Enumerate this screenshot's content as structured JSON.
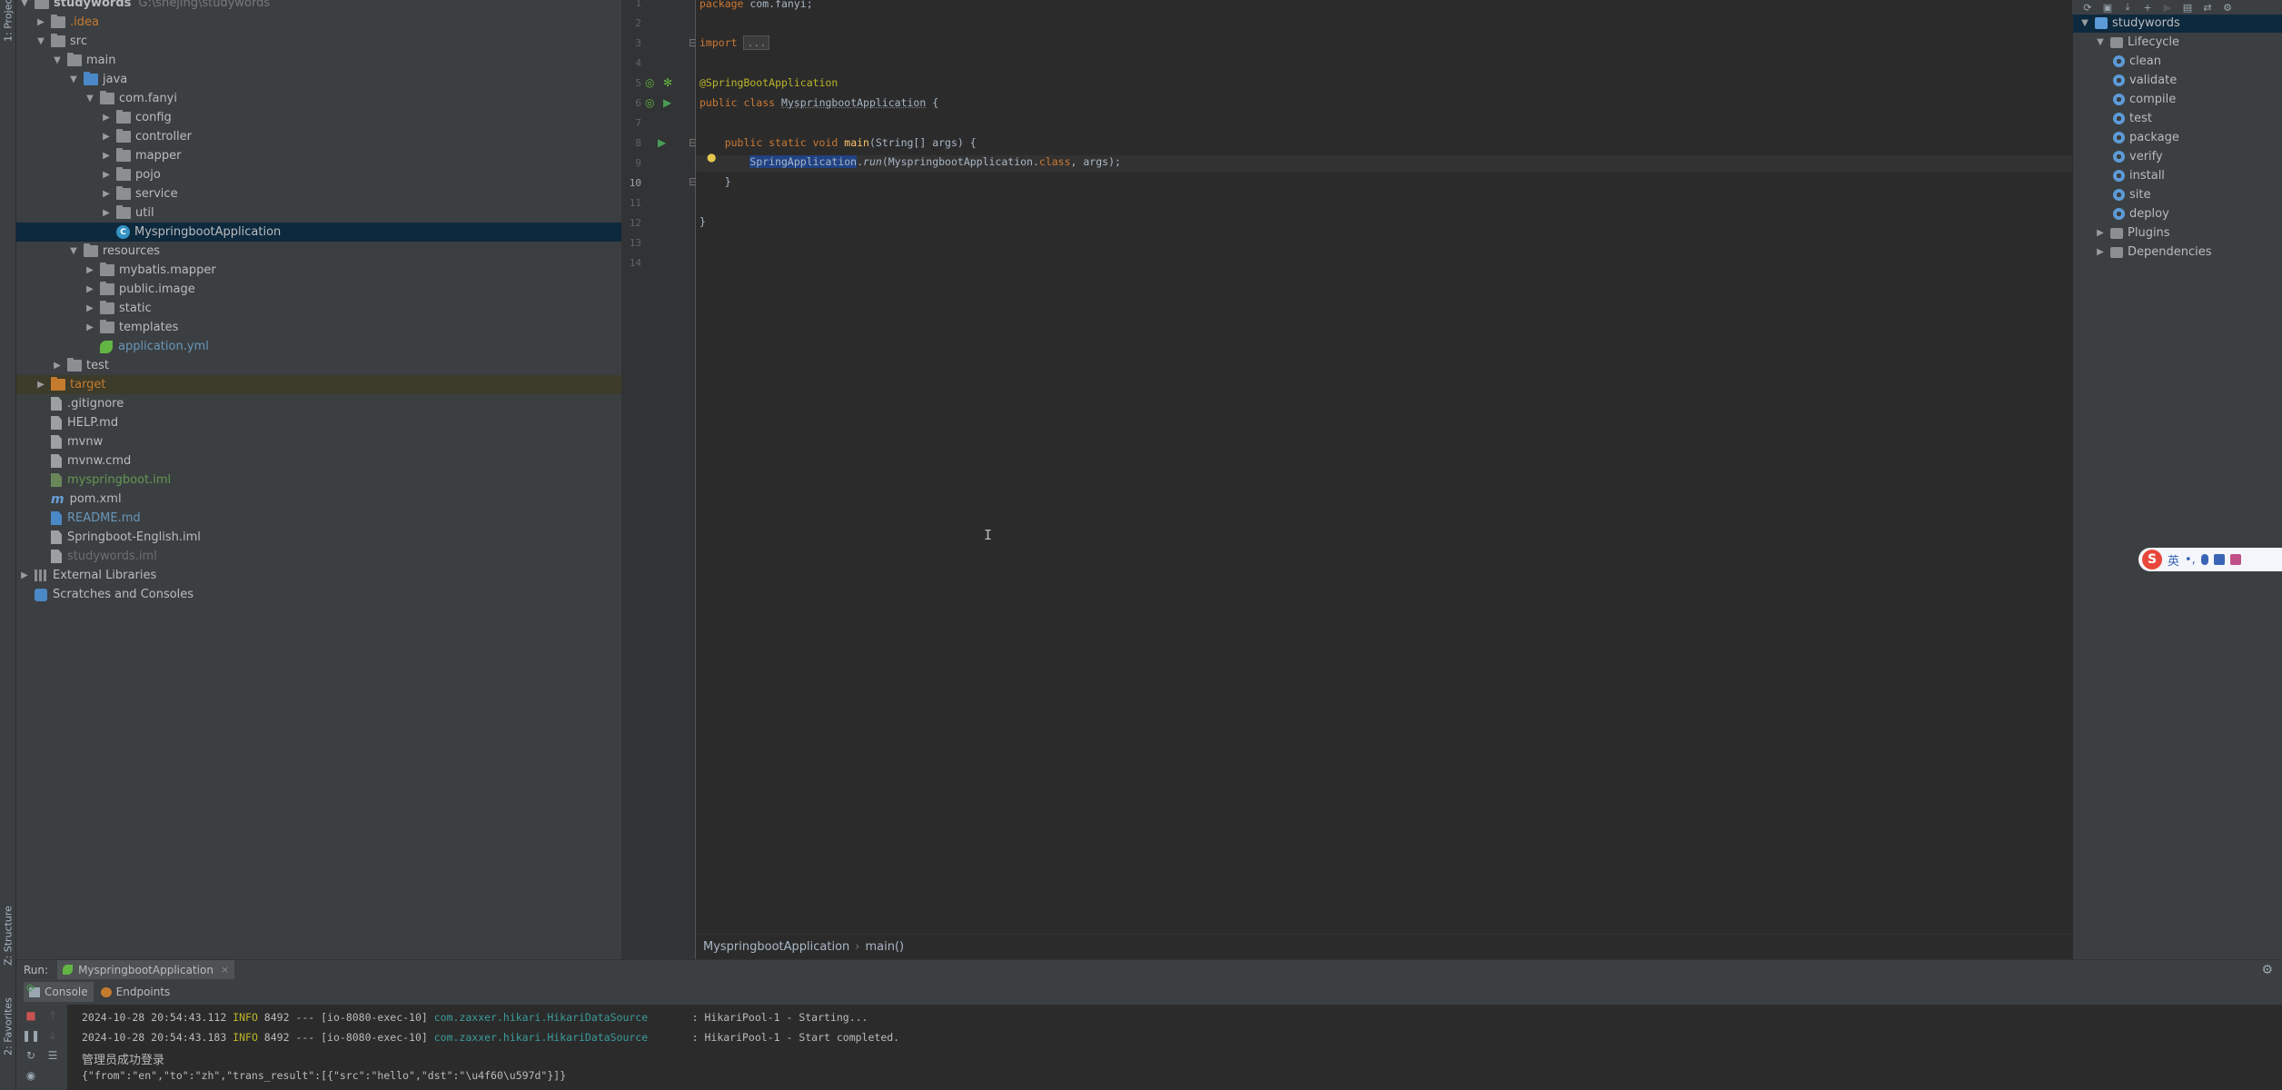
{
  "left_strip": {
    "project_tab": "1: Project",
    "structure_tab": "Z: Structure",
    "favorites_tab": "2: Favorites"
  },
  "project": {
    "root_name": "studywords",
    "root_path": "G:\\shejing\\studywords",
    "tree": [
      {
        "label": "studywords",
        "depth": 0,
        "expanded": true,
        "icon": "folder",
        "color": "#bbbbbb",
        "bold": true
      },
      {
        "label": ".idea",
        "depth": 1,
        "expanded": false,
        "icon": "folder",
        "color": "#c57b2e"
      },
      {
        "label": "src",
        "depth": 1,
        "expanded": true,
        "icon": "folder",
        "color": "#bbbbbb"
      },
      {
        "label": "main",
        "depth": 2,
        "expanded": true,
        "icon": "folder",
        "color": "#bbbbbb"
      },
      {
        "label": "java",
        "depth": 3,
        "expanded": true,
        "icon": "folder-blue",
        "color": "#bbbbbb"
      },
      {
        "label": "com.fanyi",
        "depth": 4,
        "expanded": true,
        "icon": "folder",
        "color": "#bbbbbb"
      },
      {
        "label": "config",
        "depth": 5,
        "expanded": false,
        "icon": "folder",
        "color": "#bbbbbb"
      },
      {
        "label": "controller",
        "depth": 5,
        "expanded": false,
        "icon": "folder",
        "color": "#bbbbbb"
      },
      {
        "label": "mapper",
        "depth": 5,
        "expanded": false,
        "icon": "folder",
        "color": "#bbbbbb"
      },
      {
        "label": "pojo",
        "depth": 5,
        "expanded": false,
        "icon": "folder",
        "color": "#bbbbbb"
      },
      {
        "label": "service",
        "depth": 5,
        "expanded": false,
        "icon": "folder",
        "color": "#bbbbbb"
      },
      {
        "label": "util",
        "depth": 5,
        "expanded": false,
        "icon": "folder",
        "color": "#bbbbbb"
      },
      {
        "label": "MyspringbootApplication",
        "depth": 5,
        "expanded": null,
        "icon": "class",
        "color": "#bbbbbb",
        "selected": true
      },
      {
        "label": "resources",
        "depth": 3,
        "expanded": true,
        "icon": "folder-res",
        "color": "#bbbbbb"
      },
      {
        "label": "mybatis.mapper",
        "depth": 4,
        "expanded": false,
        "icon": "folder",
        "color": "#bbbbbb"
      },
      {
        "label": "public.image",
        "depth": 4,
        "expanded": false,
        "icon": "folder",
        "color": "#bbbbbb"
      },
      {
        "label": "static",
        "depth": 4,
        "expanded": false,
        "icon": "folder",
        "color": "#bbbbbb"
      },
      {
        "label": "templates",
        "depth": 4,
        "expanded": false,
        "icon": "folder",
        "color": "#bbbbbb"
      },
      {
        "label": "application.yml",
        "depth": 4,
        "expanded": null,
        "icon": "spring",
        "color": "#6897bb"
      },
      {
        "label": "test",
        "depth": 2,
        "expanded": false,
        "icon": "folder",
        "color": "#bbbbbb"
      },
      {
        "label": "target",
        "depth": 1,
        "expanded": false,
        "icon": "folder-orange",
        "color": "#c57b2e",
        "excluded": true
      },
      {
        "label": ".gitignore",
        "depth": 1,
        "expanded": null,
        "icon": "file",
        "color": "#bbbbbb"
      },
      {
        "label": "HELP.md",
        "depth": 1,
        "expanded": null,
        "icon": "file",
        "color": "#bbbbbb"
      },
      {
        "label": "mvnw",
        "depth": 1,
        "expanded": null,
        "icon": "file",
        "color": "#bbbbbb"
      },
      {
        "label": "mvnw.cmd",
        "depth": 1,
        "expanded": null,
        "icon": "file",
        "color": "#bbbbbb"
      },
      {
        "label": "myspringboot.iml",
        "depth": 1,
        "expanded": null,
        "icon": "file-green",
        "color": "#629755"
      },
      {
        "label": "pom.xml",
        "depth": 1,
        "expanded": null,
        "icon": "maven",
        "color": "#bbbbbb"
      },
      {
        "label": "README.md",
        "depth": 1,
        "expanded": null,
        "icon": "file-md",
        "color": "#6897bb"
      },
      {
        "label": "Springboot-English.iml",
        "depth": 1,
        "expanded": null,
        "icon": "file",
        "color": "#bbbbbb"
      },
      {
        "label": "studywords.iml",
        "depth": 1,
        "expanded": null,
        "icon": "file",
        "color": "#6e6e6e"
      },
      {
        "label": "External Libraries",
        "depth": 0,
        "expanded": false,
        "icon": "library",
        "color": "#bbbbbb"
      },
      {
        "label": "Scratches and Consoles",
        "depth": 0,
        "expanded": null,
        "icon": "scratch",
        "color": "#bbbbbb"
      }
    ]
  },
  "editor": {
    "line_numbers": [
      "1",
      "2",
      "3",
      "4",
      "5",
      "6",
      "7",
      "8",
      "9",
      "10",
      "11",
      "12",
      "13",
      "14"
    ],
    "current_line": "10",
    "lines": {
      "l1_kw": "package",
      "l1_rest": " com.fanyi;",
      "l3_kw": "import",
      "l3_fold": "...",
      "l6_ann": "@SpringBootApplication",
      "l7_kw": "public class",
      "l7_name": "MyspringbootApplication",
      "l7_rest": " {",
      "l9_kw": "public static void",
      "l9_fn": "main",
      "l9_rest": "(String[] args) {",
      "l10_hl": "SpringApplication",
      "l10_dot": ".",
      "l10_call": "run",
      "l10_arg": "(MyspringbootApplication.",
      "l10_kw": "class",
      "l10_rest": ", args);",
      "l11": "}",
      "l13": "}"
    }
  },
  "breadcrumb": {
    "items": [
      "MyspringbootApplication",
      "main()"
    ]
  },
  "maven": {
    "rows": [
      {
        "label": "studywords",
        "depth": 0,
        "expanded": true,
        "icon": "project",
        "selected": true
      },
      {
        "label": "Lifecycle",
        "depth": 1,
        "expanded": true,
        "icon": "group"
      },
      {
        "label": "clean",
        "depth": 2,
        "icon": "goal"
      },
      {
        "label": "validate",
        "depth": 2,
        "icon": "goal"
      },
      {
        "label": "compile",
        "depth": 2,
        "icon": "goal"
      },
      {
        "label": "test",
        "depth": 2,
        "icon": "goal"
      },
      {
        "label": "package",
        "depth": 2,
        "icon": "goal"
      },
      {
        "label": "verify",
        "depth": 2,
        "icon": "goal"
      },
      {
        "label": "install",
        "depth": 2,
        "icon": "goal"
      },
      {
        "label": "site",
        "depth": 2,
        "icon": "goal"
      },
      {
        "label": "deploy",
        "depth": 2,
        "icon": "goal"
      },
      {
        "label": "Plugins",
        "depth": 1,
        "expanded": false,
        "icon": "group"
      },
      {
        "label": "Dependencies",
        "depth": 1,
        "expanded": false,
        "icon": "group"
      }
    ]
  },
  "ime": {
    "lang": "英",
    "punct": "•,"
  },
  "run": {
    "label": "Run:",
    "tab_title": "MyspringbootApplication",
    "console_tab": "Console",
    "endpoints_tab": "Endpoints",
    "lines": [
      {
        "ts": "2024-10-28 20:54:43.112",
        "level": "INFO",
        "pid": "8492",
        "sep": "---",
        "thread": "[io-8080-exec-10]",
        "logger": "com.zaxxer.hikari.HikariDataSource",
        "msg": ": HikariPool-1 - Starting..."
      },
      {
        "ts": "2024-10-28 20:54:43.183",
        "level": "INFO",
        "pid": "8492",
        "sep": "---",
        "thread": "[io-8080-exec-10]",
        "logger": "com.zaxxer.hikari.HikariDataSource",
        "msg": ": HikariPool-1 - Start completed."
      }
    ],
    "plain_line": "管理员成功登录",
    "json_line": "{\"from\":\"en\",\"to\":\"zh\",\"trans_result\":[{\"src\":\"hello\",\"dst\":\"\\u4f60\\u597d\"}]}"
  }
}
